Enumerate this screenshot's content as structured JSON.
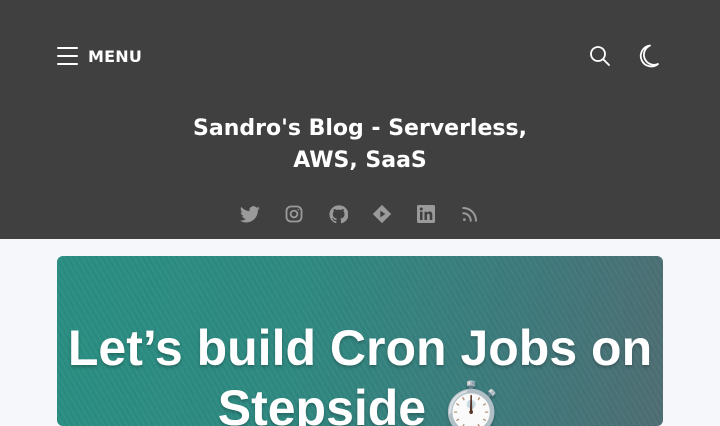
{
  "header": {
    "menu_label": "MENU",
    "site_title": "Sandro's Blog - Serverless, AWS, SaaS",
    "icons": [
      "menu-icon",
      "search-icon",
      "dark-mode-moon-icon"
    ],
    "background": "#404040"
  },
  "social": {
    "icons": [
      "twitter-icon",
      "instagram-icon",
      "github-icon",
      "dev-community-icon",
      "linkedin-icon",
      "rss-icon"
    ]
  },
  "featured_post": {
    "image_text": "Let’s build Cron Jobs on Stepside ⏱️",
    "gradient_start": "#2a8f82",
    "gradient_end": "#4f6e73"
  }
}
